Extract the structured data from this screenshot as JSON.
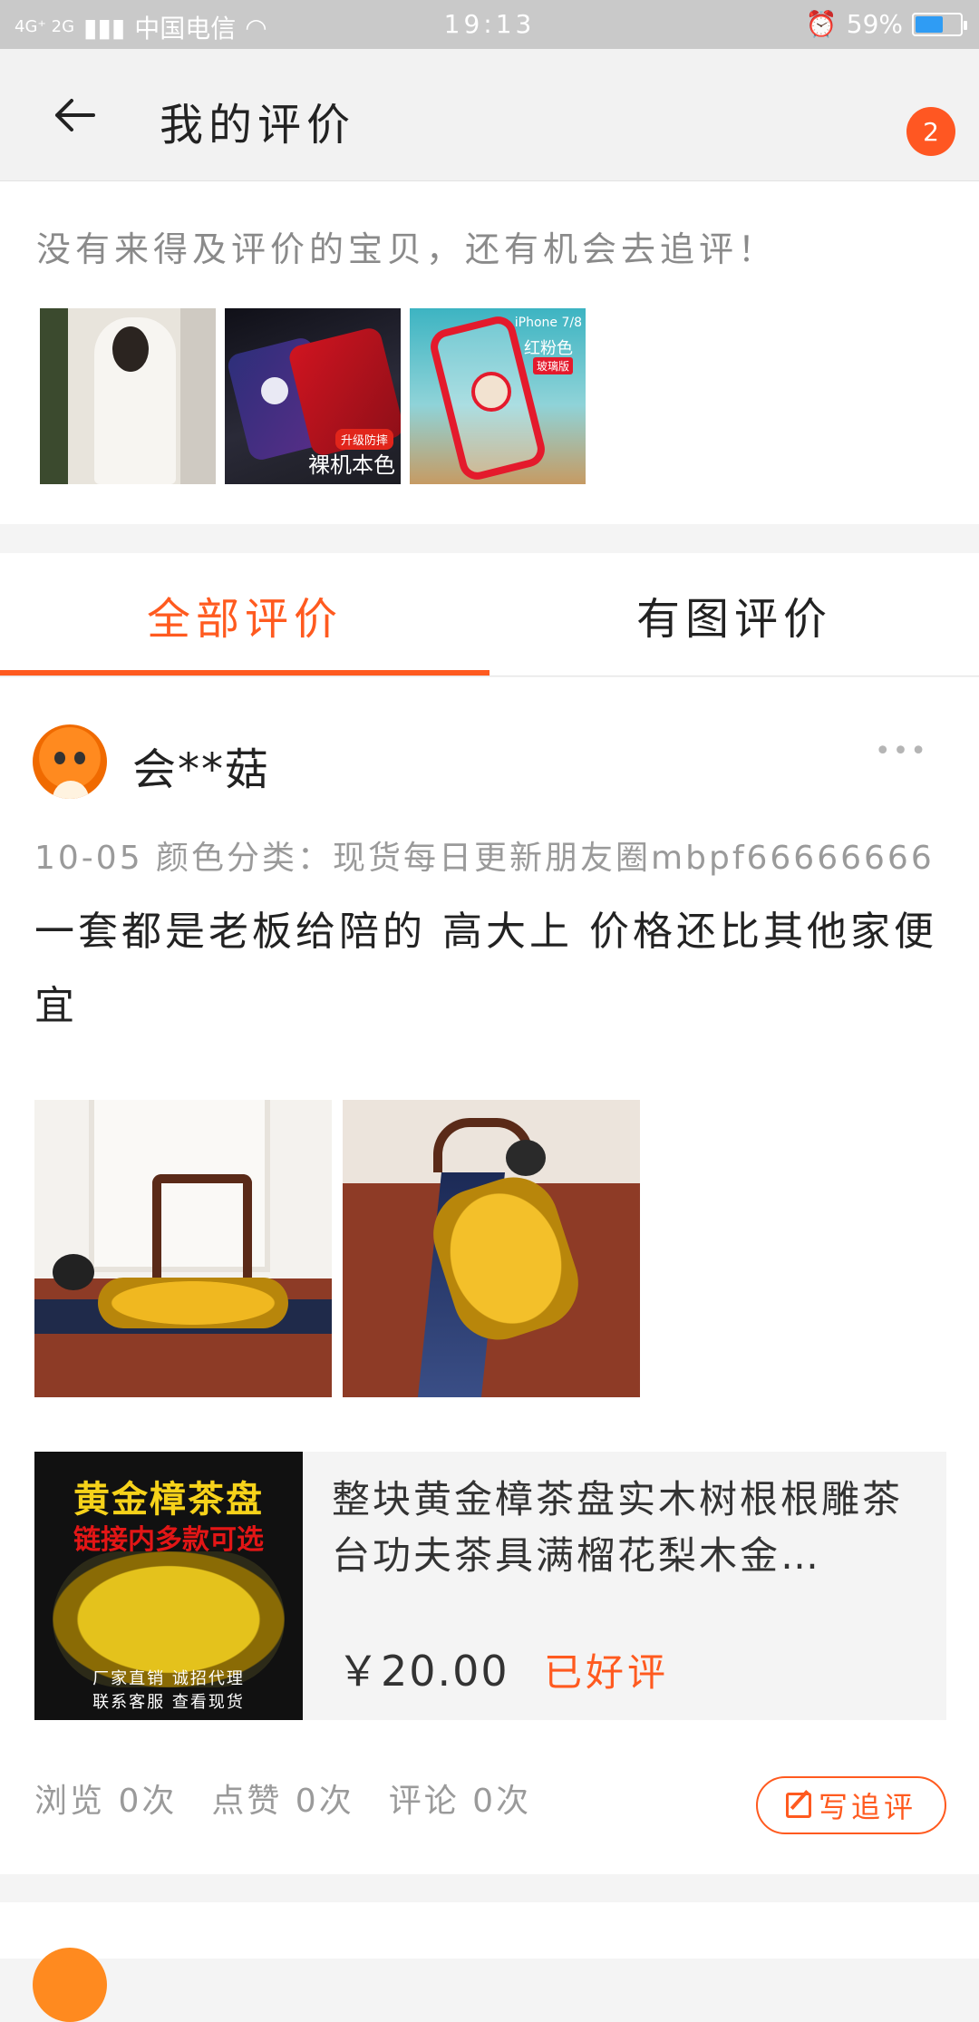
{
  "status_bar": {
    "network": "4G⁺ 2G",
    "carrier": "中国电信",
    "time": "19:13",
    "battery": "59%"
  },
  "header": {
    "title": "我的评价",
    "badge_count": "2"
  },
  "prompt": {
    "text": "没有来得及评价的宝贝，还有机会去追评！",
    "thumb2_tag": "升级防摔",
    "thumb2_caption": "裸机本色",
    "thumb3_model": "iPhone 7/8",
    "thumb3_color": "红粉色",
    "thumb3_tag": "玻璃版"
  },
  "tabs": {
    "all": "全部评价",
    "with_photos": "有图评价"
  },
  "review": {
    "username": "会**菇",
    "more": "•••",
    "meta": "10-05 颜色分类：现货每日更新朋友圈mbpf66666666",
    "text": "一套都是老板给陪的 高大上 价格还比其他家便宜",
    "product": {
      "image_text_1": "黄金樟茶盘",
      "image_text_2": "链接内多款可选",
      "image_text_3": "厂家直销 诚招代理",
      "image_text_4": "联系客服 查看现货",
      "title": "整块黄金樟茶盘实木树根根雕茶台功夫茶具满榴花梨木金…",
      "price": "￥20.00",
      "status": "已好评"
    },
    "stats": {
      "views": "浏览 0次",
      "likes": "点赞 0次",
      "comments": "评论 0次"
    },
    "follow_up_label": "写追评"
  },
  "colors": {
    "accent": "#ff5a1f",
    "badge": "#ff5722",
    "status_bar": "#c9c9c9"
  }
}
